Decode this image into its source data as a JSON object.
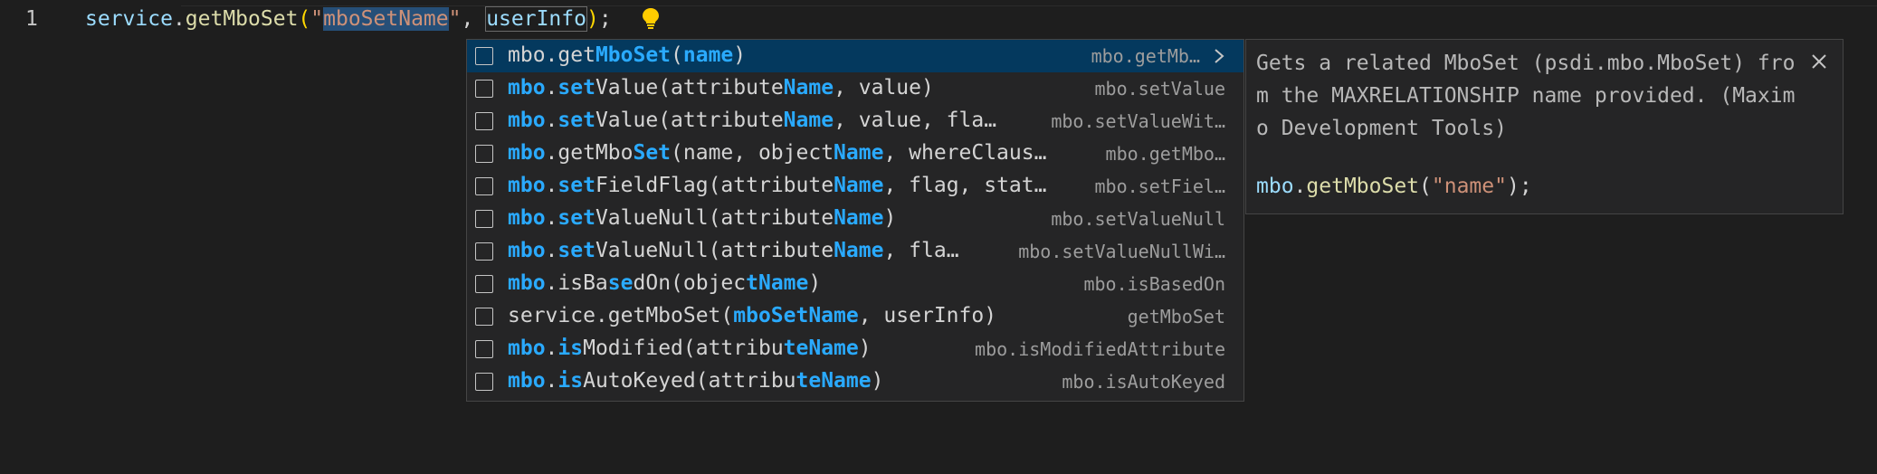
{
  "editor": {
    "line_number": "1",
    "code": {
      "obj": "service",
      "dot": ".",
      "method": "getMboSet",
      "open_paren": "(",
      "quote_open": "\"",
      "arg1": "mboSetName",
      "quote_close": "\"",
      "comma": ", ",
      "arg2": "userInfo",
      "close_paren": ")",
      "semi": ";"
    },
    "lightbulb_icon": "lightbulb-icon"
  },
  "suggestions": [
    {
      "segments": [
        {
          "t": "mbo.get",
          "h": false
        },
        {
          "t": "MboSet",
          "h": true
        },
        {
          "t": "(",
          "h": false
        },
        {
          "t": "name",
          "h": true
        },
        {
          "t": ")",
          "h": false
        }
      ],
      "detail": "mbo.getMb…",
      "focused": true
    },
    {
      "segments": [
        {
          "t": "mbo",
          "h": true
        },
        {
          "t": ".",
          "h": false
        },
        {
          "t": "set",
          "h": true
        },
        {
          "t": "Value(attribute",
          "h": false
        },
        {
          "t": "Name",
          "h": true
        },
        {
          "t": ", value)",
          "h": false
        }
      ],
      "detail": "mbo.setValue"
    },
    {
      "segments": [
        {
          "t": "mbo",
          "h": true
        },
        {
          "t": ".",
          "h": false
        },
        {
          "t": "set",
          "h": true
        },
        {
          "t": "Value(attribute",
          "h": false
        },
        {
          "t": "Name",
          "h": true
        },
        {
          "t": ", value, fla…",
          "h": false
        }
      ],
      "detail": "mbo.setValueWit…"
    },
    {
      "segments": [
        {
          "t": "mbo",
          "h": true
        },
        {
          "t": ".getMbo",
          "h": false
        },
        {
          "t": "Set",
          "h": true
        },
        {
          "t": "(name, object",
          "h": false
        },
        {
          "t": "Name",
          "h": true
        },
        {
          "t": ", whereClaus…",
          "h": false
        }
      ],
      "detail": "mbo.getMbo…"
    },
    {
      "segments": [
        {
          "t": "mbo",
          "h": true
        },
        {
          "t": ".",
          "h": false
        },
        {
          "t": "set",
          "h": true
        },
        {
          "t": "FieldFlag(attribute",
          "h": false
        },
        {
          "t": "Name",
          "h": true
        },
        {
          "t": ", flag, stat…",
          "h": false
        }
      ],
      "detail": "mbo.setFiel…"
    },
    {
      "segments": [
        {
          "t": "mbo",
          "h": true
        },
        {
          "t": ".",
          "h": false
        },
        {
          "t": "set",
          "h": true
        },
        {
          "t": "ValueNull(attribute",
          "h": false
        },
        {
          "t": "Name",
          "h": true
        },
        {
          "t": ")",
          "h": false
        }
      ],
      "detail": "mbo.setValueNull"
    },
    {
      "segments": [
        {
          "t": "mbo",
          "h": true
        },
        {
          "t": ".",
          "h": false
        },
        {
          "t": "set",
          "h": true
        },
        {
          "t": "ValueNull(attribute",
          "h": false
        },
        {
          "t": "Name",
          "h": true
        },
        {
          "t": ", fla…",
          "h": false
        }
      ],
      "detail": "mbo.setValueNullWi…"
    },
    {
      "segments": [
        {
          "t": "mbo",
          "h": true
        },
        {
          "t": ".isBa",
          "h": false
        },
        {
          "t": "se",
          "h": true
        },
        {
          "t": "dOn(objec",
          "h": false
        },
        {
          "t": "tName",
          "h": true
        },
        {
          "t": ")",
          "h": false
        }
      ],
      "detail": "mbo.isBasedOn"
    },
    {
      "segments": [
        {
          "t": "service.getMboSet(",
          "h": false
        },
        {
          "t": "mboSetName",
          "h": true
        },
        {
          "t": ", userInfo)",
          "h": false
        }
      ],
      "detail": "getMboSet"
    },
    {
      "segments": [
        {
          "t": "mbo",
          "h": true
        },
        {
          "t": ".",
          "h": false
        },
        {
          "t": "is",
          "h": true
        },
        {
          "t": "Modified(attribu",
          "h": false
        },
        {
          "t": "teName",
          "h": true
        },
        {
          "t": ")",
          "h": false
        }
      ],
      "detail": "mbo.isModifiedAttribute"
    },
    {
      "segments": [
        {
          "t": "mbo",
          "h": true
        },
        {
          "t": ".",
          "h": false
        },
        {
          "t": "is",
          "h": true
        },
        {
          "t": "AutoKeyed(attribu",
          "h": false
        },
        {
          "t": "teName",
          "h": true
        },
        {
          "t": ")",
          "h": false
        }
      ],
      "detail": "mbo.isAutoKeyed"
    }
  ],
  "details": {
    "description": "Gets a related MboSet (psdi.mbo.MboSet) from the MAXRELATIONSHIP name provided. (Maximo Development Tools)",
    "example": {
      "obj": "mbo",
      "dot": ".",
      "method": "getMboSet",
      "open_paren": "(",
      "arg": "\"name\"",
      "close": ");"
    },
    "close_icon": "close-icon"
  },
  "colors": {
    "background": "#1e1e1e",
    "widget_bg": "#252526",
    "focused_row": "#04395e",
    "match_highlight": "#2aaaff",
    "string": "#ce9178",
    "variable": "#9cdcfe",
    "function": "#dcdcaa"
  }
}
